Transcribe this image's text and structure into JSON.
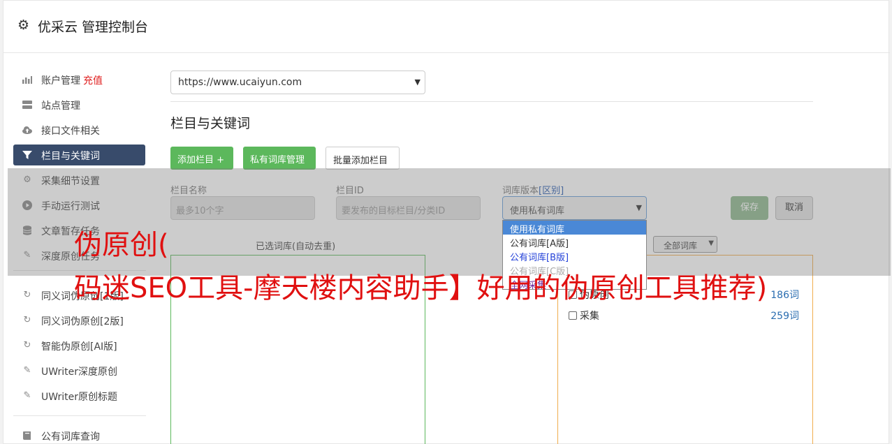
{
  "header": {
    "gear_icon": "gear-icon",
    "title": "优采云 管理控制台"
  },
  "sidebar": {
    "items": [
      {
        "label": "账户管理",
        "extra": "充值",
        "icon": "bar-chart-icon"
      },
      {
        "label": "站点管理",
        "icon": "server-icon"
      },
      {
        "label": "接口文件相关",
        "icon": "cloud-upload-icon"
      },
      {
        "label": "栏目与关键词",
        "icon": "filter-icon",
        "active": true
      },
      {
        "label": "采集细节设置",
        "icon": "gears-icon"
      },
      {
        "label": "手动运行测试",
        "icon": "play-circle-icon"
      },
      {
        "label": "文章暂存任务",
        "icon": "database-icon"
      },
      {
        "label": "深度原创任务",
        "icon": "edit-icon"
      },
      {
        "label": "同义词伪原创[1版]",
        "icon": "refresh-icon"
      },
      {
        "label": "同义词伪原创[2版]",
        "icon": "refresh-icon"
      },
      {
        "label": "智能伪原创[AI版]",
        "icon": "refresh-icon"
      },
      {
        "label": "UWriter深度原创",
        "icon": "edit-icon"
      },
      {
        "label": "UWriter原创标题",
        "icon": "edit-icon"
      },
      {
        "label": "公有词库查询",
        "icon": "book-icon"
      }
    ]
  },
  "main": {
    "site_select": "https://www.ucaiyun.com",
    "section_title": "栏目与关键词",
    "buttons": {
      "add_column": "添加栏目 +",
      "private_lib": "私有词库管理",
      "batch_add": "批量添加栏目"
    },
    "form": {
      "name_label": "栏目名称",
      "name_placeholder": "最多10个字",
      "id_label": "栏目ID",
      "id_placeholder": "要发布的目标栏目/分类ID",
      "version_label": "词库版本",
      "version_diff": "[区别]",
      "version_value": "使用私有词库",
      "save": "保存",
      "cancel": "取消"
    },
    "version_options": [
      "使用私有词库",
      "公有词库[A版]",
      "公有词库[B版]",
      "公有词库[C版]",
      "全网采集"
    ],
    "selected_lib_label": "已选词库(自动去重)",
    "all_lib_select": "全部词库",
    "lib_items": [
      {
        "name": "伪原创",
        "count": "186词"
      },
      {
        "name": "采集",
        "count": "259词"
      }
    ]
  },
  "watermark": {
    "line1": "伪原创(",
    "line2": "码迷SEO工具-摩天楼内容助手】好用的伪原创工具推荐)"
  },
  "colors": {
    "green": "#5cb85c",
    "active_nav": "#384b6b",
    "watermark_red": "#e01010",
    "orange_border": "#f0ad4e"
  }
}
